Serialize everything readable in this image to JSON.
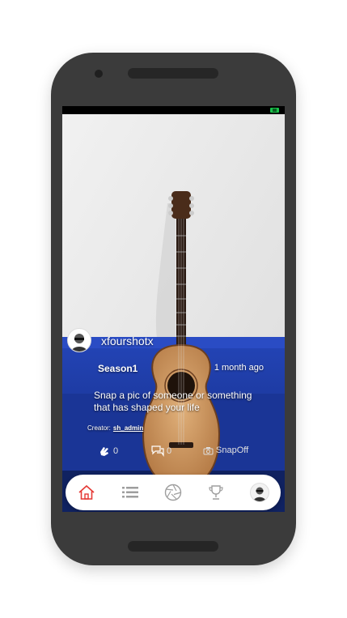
{
  "post": {
    "username": "xfourshotx",
    "season": "Season1",
    "time_ago": "1 month ago",
    "prompt": "Snap a pic of someone or something that has shaped your life",
    "creator_label": "Creator:",
    "creator_name": "sh_admin"
  },
  "actions": {
    "claps_count": "0",
    "comments_count": "0",
    "snapoff_label": "SnapOff"
  },
  "tabbar": {
    "items": [
      {
        "name": "home",
        "icon": "home-icon",
        "active": true
      },
      {
        "name": "feed",
        "icon": "list-icon",
        "active": false
      },
      {
        "name": "snap",
        "icon": "aperture-icon",
        "active": false
      },
      {
        "name": "leaderboard",
        "icon": "trophy-icon",
        "active": false
      },
      {
        "name": "profile",
        "icon": "avatar",
        "active": false
      }
    ]
  },
  "colors": {
    "accent": "#e53935",
    "battery": "#19c24a",
    "couch": "#1d3fb0",
    "wall": "#ebebeb"
  }
}
